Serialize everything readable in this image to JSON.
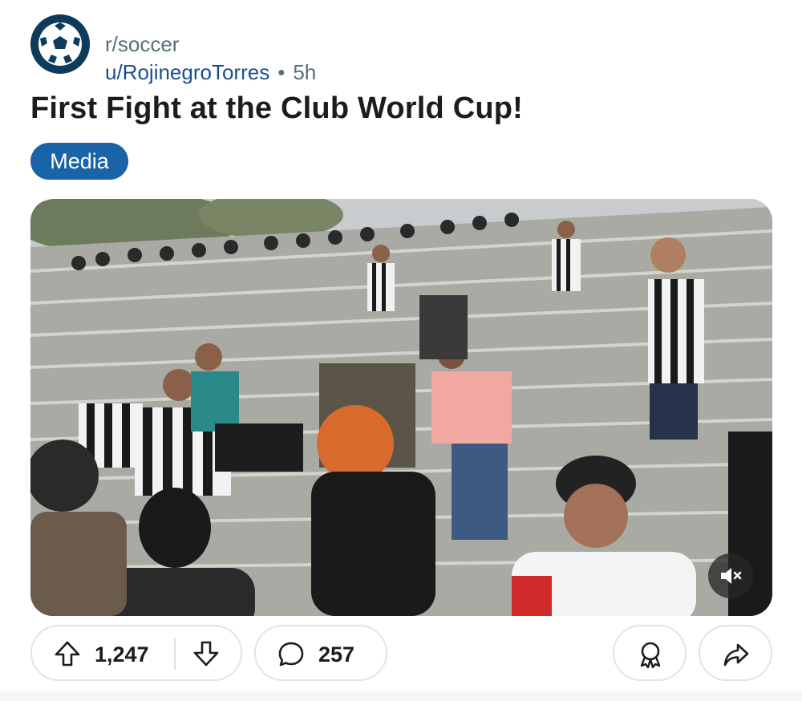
{
  "post": {
    "subreddit": "r/soccer",
    "author": "u/RojinegroTorres",
    "separator": "•",
    "age": "5h",
    "title": "First Fight at the Club World Cup!",
    "flair": "Media"
  },
  "media": {
    "type": "video",
    "description_icon": "mute-icon"
  },
  "actions": {
    "upvotes": "1,247",
    "comments": "257",
    "upvote_icon": "upvote-arrow-icon",
    "downvote_icon": "downvote-arrow-icon",
    "comment_icon": "comment-bubble-icon",
    "award_icon": "award-icon",
    "share_icon": "share-arrow-icon"
  },
  "colors": {
    "link": "#1b4f8f",
    "flair_bg": "#1b63a8",
    "muted": "#576f76",
    "avatar_bg": "#0e3a5c"
  }
}
